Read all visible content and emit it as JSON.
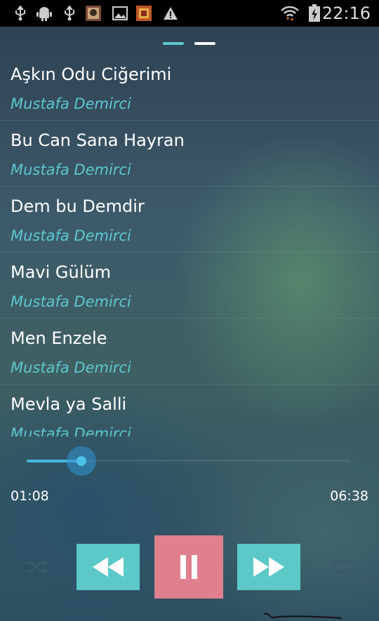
{
  "status_bar": {
    "time": "22:16",
    "left_icons": [
      "usb-icon",
      "android-debug-icon",
      "usb-icon",
      "album-thumbnail",
      "image-icon",
      "album-thumbnail",
      "warning-icon"
    ],
    "right_icons": [
      "wifi-icon",
      "battery-charging-icon"
    ]
  },
  "pager": {
    "pages": 2,
    "active_page": 1
  },
  "playlist": {
    "items": [
      {
        "title": "Aşkın Odu Ciğerimi",
        "artist": "Mustafa Demirci"
      },
      {
        "title": "Bu Can Sana Hayran",
        "artist": "Mustafa Demirci"
      },
      {
        "title": "Dem bu Demdir",
        "artist": "Mustafa Demirci"
      },
      {
        "title": "Mavi Gülüm",
        "artist": "Mustafa Demirci"
      },
      {
        "title": "Men Enzele",
        "artist": "Mustafa Demirci"
      },
      {
        "title": "Mevla ya Salli",
        "artist": "Mustafa Demirci"
      }
    ]
  },
  "player": {
    "elapsed": "01:08",
    "duration": "06:38",
    "progress": 0.17
  },
  "colors": {
    "accent_teal": "#5cc8c8",
    "artist_text": "#5cc8cf",
    "pause_button": "#e0808f",
    "seek_active": "#44b8e2"
  }
}
